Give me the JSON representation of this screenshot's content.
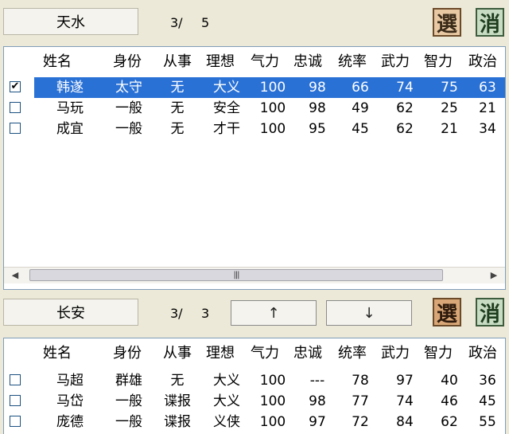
{
  "top": {
    "city": "天水",
    "counter_current": "3/",
    "counter_total": "5",
    "select_label": "選",
    "cancel_label": "消"
  },
  "columns": [
    "姓名",
    "身份",
    "从事",
    "理想",
    "气力",
    "忠诚",
    "统率",
    "武力",
    "智力",
    "政治"
  ],
  "top_rows": [
    {
      "checked": true,
      "check_mark": "✔",
      "name": "韩遂",
      "status": "太守",
      "job": "无",
      "ideal": "大义",
      "power": "100",
      "loyalty": "98",
      "lead": "66",
      "war": "74",
      "intel": "75",
      "pol": "63"
    },
    {
      "checked": false,
      "check_mark": "",
      "name": "马玩",
      "status": "一般",
      "job": "无",
      "ideal": "安全",
      "power": "100",
      "loyalty": "98",
      "lead": "49",
      "war": "62",
      "intel": "25",
      "pol": "21"
    },
    {
      "checked": false,
      "check_mark": "",
      "name": "成宜",
      "status": "一般",
      "job": "无",
      "ideal": "才干",
      "power": "100",
      "loyalty": "95",
      "lead": "45",
      "war": "62",
      "intel": "21",
      "pol": "34"
    }
  ],
  "scrollbar": {
    "left_arrow": "◀",
    "right_arrow": "▶",
    "thumb_grip": "|||"
  },
  "bottom": {
    "city": "长安",
    "counter_current": "3/",
    "counter_total": "3",
    "up_label": "↑",
    "down_label": "↓",
    "select_label": "選",
    "cancel_label": "消"
  },
  "bottom_rows": [
    {
      "checked": false,
      "check_mark": "",
      "name": "马超",
      "status": "群雄",
      "job": "无",
      "ideal": "大义",
      "power": "100",
      "loyalty": "---",
      "lead": "78",
      "war": "97",
      "intel": "40",
      "pol": "36"
    },
    {
      "checked": false,
      "check_mark": "",
      "name": "马岱",
      "status": "一般",
      "job": "谍报",
      "ideal": "大义",
      "power": "100",
      "loyalty": "98",
      "lead": "77",
      "war": "74",
      "intel": "46",
      "pol": "45"
    },
    {
      "checked": false,
      "check_mark": "",
      "name": "庞德",
      "status": "一般",
      "job": "谍报",
      "ideal": "义侠",
      "power": "100",
      "loyalty": "97",
      "lead": "72",
      "war": "84",
      "intel": "62",
      "pol": "55"
    }
  ],
  "colors": {
    "selection": "#2a71d6",
    "panel_border": "#7f9db9",
    "background": "#ece9d8"
  }
}
